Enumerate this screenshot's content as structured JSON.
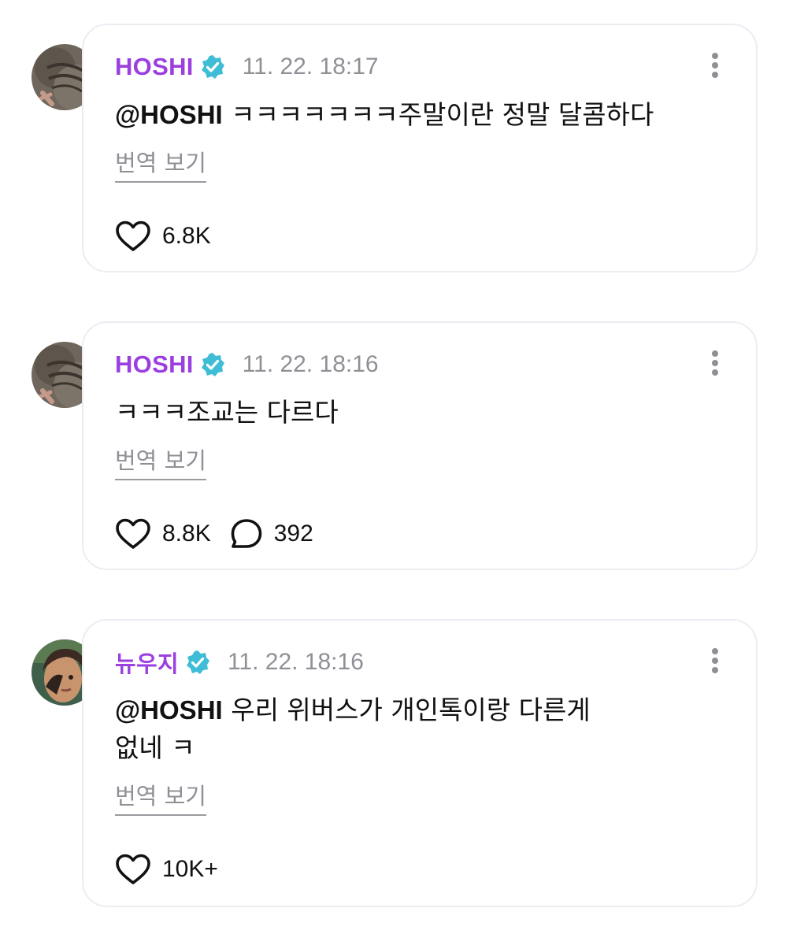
{
  "colors": {
    "author": "#9b3fe0",
    "verified_badge": "#3fbcd6",
    "muted_text": "#8f8f96",
    "card_border": "#ececf3"
  },
  "posts": [
    {
      "author": "HOSHI",
      "verified": true,
      "time": "11. 22. 18:17",
      "mention": "@HOSHI",
      "text": "ㅋㅋㅋㅋㅋㅋㅋ주말이란 정말 달콤하다",
      "text_line2": "",
      "translate_label": "번역 보기",
      "like_count": "6.8K",
      "comment_count": "",
      "like_icon": "heart-icon",
      "comment_icon": "comment-bubble-icon",
      "more_icon": "more-vertical-icon"
    },
    {
      "author": "HOSHI",
      "verified": true,
      "time": "11. 22. 18:16",
      "mention": "",
      "text": "ㅋㅋㅋ조교는 다르다",
      "text_line2": "",
      "translate_label": "번역 보기",
      "like_count": "8.8K",
      "comment_count": "392",
      "like_icon": "heart-icon",
      "comment_icon": "comment-bubble-icon",
      "more_icon": "more-vertical-icon"
    },
    {
      "author": "뉴우지",
      "verified": true,
      "time": "11. 22. 18:16",
      "mention": "@HOSHI",
      "text": "우리 위버스가 개인톡이랑 다른게",
      "text_line2": "없네 ㅋ",
      "translate_label": "번역 보기",
      "like_count": "10K+",
      "comment_count": "",
      "like_icon": "heart-icon",
      "comment_icon": "comment-bubble-icon",
      "more_icon": "more-vertical-icon"
    }
  ]
}
